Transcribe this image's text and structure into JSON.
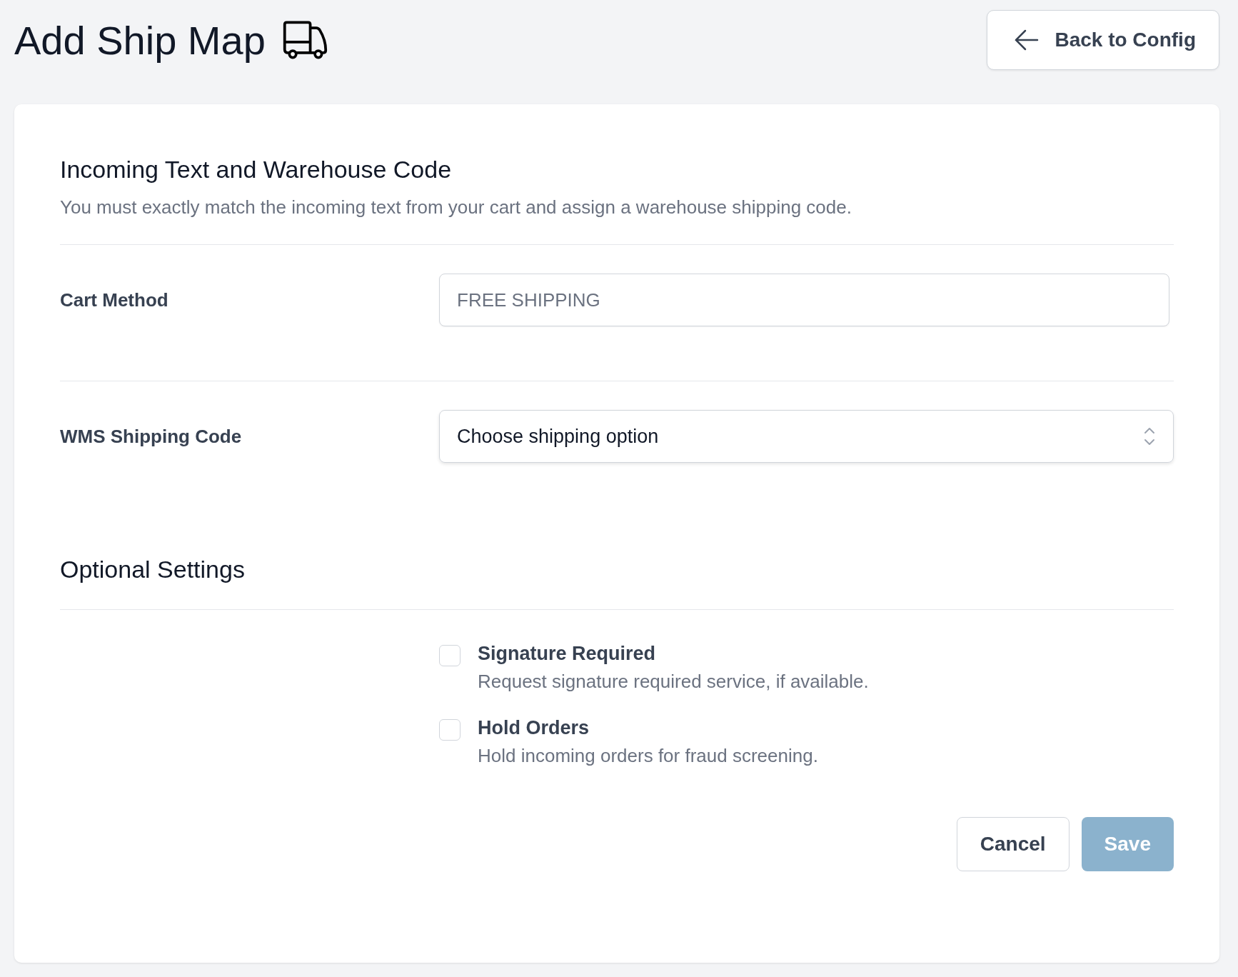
{
  "page": {
    "title": "Add Ship Map",
    "back_button": "Back to Config"
  },
  "mapping_section": {
    "title": "Incoming Text and Warehouse Code",
    "description": "You must exactly match the incoming text from your cart and assign a warehouse shipping code.",
    "fields": [
      {
        "kind": "text",
        "label": "Cart Method",
        "placeholder": "FREE SHIPPING"
      },
      {
        "kind": "select",
        "label": "WMS Shipping Code",
        "value": "Choose shipping option"
      }
    ]
  },
  "optional_section": {
    "title": "Optional Settings",
    "options": [
      {
        "label": "Signature Required",
        "description": "Request signature required service, if available.",
        "checked": false
      },
      {
        "label": "Hold Orders",
        "description": "Hold incoming orders for fraud screening.",
        "checked": false
      }
    ]
  },
  "actions": [
    {
      "kind": "secondary",
      "label": "Cancel",
      "disabled": false
    },
    {
      "kind": "primary",
      "label": "Save",
      "disabled": true
    }
  ]
}
